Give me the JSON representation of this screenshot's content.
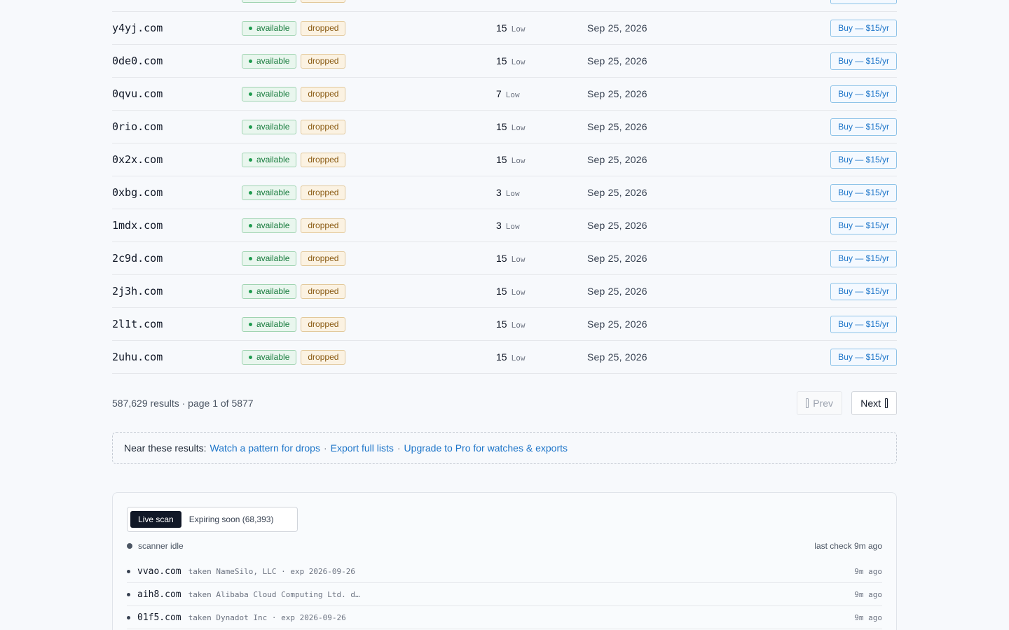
{
  "results": {
    "rows": [
      {
        "domain": "y4yj.com",
        "status": "available",
        "tag": "dropped",
        "score": "15",
        "level": "Low",
        "expires": "Sep 25, 2026",
        "action": "Buy — $15/yr"
      },
      {
        "domain": "0de0.com",
        "status": "available",
        "tag": "dropped",
        "score": "15",
        "level": "Low",
        "expires": "Sep 25, 2026",
        "action": "Buy — $15/yr"
      },
      {
        "domain": "0qvu.com",
        "status": "available",
        "tag": "dropped",
        "score": "7",
        "level": "Low",
        "expires": "Sep 25, 2026",
        "action": "Buy — $15/yr"
      },
      {
        "domain": "0rio.com",
        "status": "available",
        "tag": "dropped",
        "score": "15",
        "level": "Low",
        "expires": "Sep 25, 2026",
        "action": "Buy — $15/yr"
      },
      {
        "domain": "0x2x.com",
        "status": "available",
        "tag": "dropped",
        "score": "15",
        "level": "Low",
        "expires": "Sep 25, 2026",
        "action": "Buy — $15/yr"
      },
      {
        "domain": "0xbg.com",
        "status": "available",
        "tag": "dropped",
        "score": "3",
        "level": "Low",
        "expires": "Sep 25, 2026",
        "action": "Buy — $15/yr"
      },
      {
        "domain": "1mdx.com",
        "status": "available",
        "tag": "dropped",
        "score": "3",
        "level": "Low",
        "expires": "Sep 25, 2026",
        "action": "Buy — $15/yr"
      },
      {
        "domain": "2c9d.com",
        "status": "available",
        "tag": "dropped",
        "score": "15",
        "level": "Low",
        "expires": "Sep 25, 2026",
        "action": "Buy — $15/yr"
      },
      {
        "domain": "2j3h.com",
        "status": "available",
        "tag": "dropped",
        "score": "15",
        "level": "Low",
        "expires": "Sep 25, 2026",
        "action": "Buy — $15/yr"
      },
      {
        "domain": "2l1t.com",
        "status": "available",
        "tag": "dropped",
        "score": "15",
        "level": "Low",
        "expires": "Sep 25, 2026",
        "action": "Buy — $15/yr"
      },
      {
        "domain": "2uhu.com",
        "status": "available",
        "tag": "dropped",
        "score": "15",
        "level": "Low",
        "expires": "Sep 25, 2026",
        "action": "Buy — $15/yr"
      }
    ]
  },
  "pagination": {
    "summary": "587,629 results · page 1 of 5877",
    "prev_label": "Prev",
    "next_label": "Next"
  },
  "note": {
    "label": "Near these results:",
    "links": [
      "Watch a pattern for drops",
      "Export full lists",
      "Upgrade to Pro for watches & exports"
    ],
    "separator": "·"
  },
  "live_scan": {
    "tabs": [
      "Live scan",
      "Expiring soon (68,393)"
    ],
    "status": "scanner idle",
    "last_check": "last check 9m ago",
    "feed": [
      {
        "domain": "vvao.com",
        "info": "taken  NameSilo, LLC · exp 2026-09-26",
        "ago": "9m ago"
      },
      {
        "domain": "aih8.com",
        "info": "taken  Alibaba Cloud Computing Ltd. d…",
        "ago": "9m ago"
      },
      {
        "domain": "01f5.com",
        "info": "taken  Dynadot Inc · exp 2026-09-26",
        "ago": "9m ago"
      }
    ]
  },
  "colors": {
    "accent": "#1d75c9",
    "available": "#157a3b",
    "dropped": "#8a5a12"
  }
}
